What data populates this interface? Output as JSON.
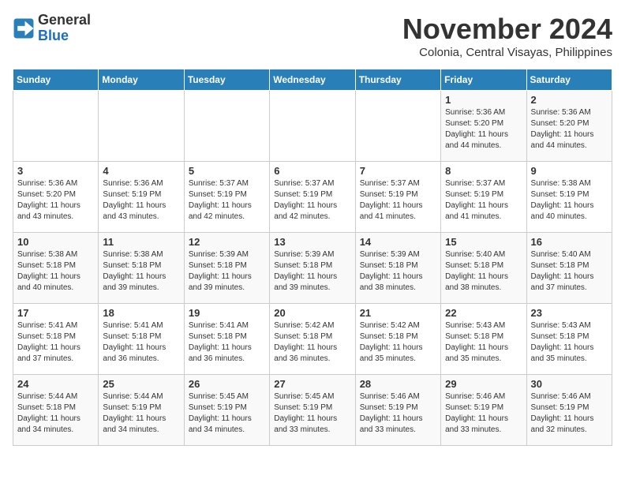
{
  "logo": {
    "line1": "General",
    "line2": "Blue"
  },
  "title": "November 2024",
  "subtitle": "Colonia, Central Visayas, Philippines",
  "days_of_week": [
    "Sunday",
    "Monday",
    "Tuesday",
    "Wednesday",
    "Thursday",
    "Friday",
    "Saturday"
  ],
  "weeks": [
    [
      {
        "day": "",
        "info": ""
      },
      {
        "day": "",
        "info": ""
      },
      {
        "day": "",
        "info": ""
      },
      {
        "day": "",
        "info": ""
      },
      {
        "day": "",
        "info": ""
      },
      {
        "day": "1",
        "info": "Sunrise: 5:36 AM\nSunset: 5:20 PM\nDaylight: 11 hours\nand 44 minutes."
      },
      {
        "day": "2",
        "info": "Sunrise: 5:36 AM\nSunset: 5:20 PM\nDaylight: 11 hours\nand 44 minutes."
      }
    ],
    [
      {
        "day": "3",
        "info": "Sunrise: 5:36 AM\nSunset: 5:20 PM\nDaylight: 11 hours\nand 43 minutes."
      },
      {
        "day": "4",
        "info": "Sunrise: 5:36 AM\nSunset: 5:19 PM\nDaylight: 11 hours\nand 43 minutes."
      },
      {
        "day": "5",
        "info": "Sunrise: 5:37 AM\nSunset: 5:19 PM\nDaylight: 11 hours\nand 42 minutes."
      },
      {
        "day": "6",
        "info": "Sunrise: 5:37 AM\nSunset: 5:19 PM\nDaylight: 11 hours\nand 42 minutes."
      },
      {
        "day": "7",
        "info": "Sunrise: 5:37 AM\nSunset: 5:19 PM\nDaylight: 11 hours\nand 41 minutes."
      },
      {
        "day": "8",
        "info": "Sunrise: 5:37 AM\nSunset: 5:19 PM\nDaylight: 11 hours\nand 41 minutes."
      },
      {
        "day": "9",
        "info": "Sunrise: 5:38 AM\nSunset: 5:19 PM\nDaylight: 11 hours\nand 40 minutes."
      }
    ],
    [
      {
        "day": "10",
        "info": "Sunrise: 5:38 AM\nSunset: 5:18 PM\nDaylight: 11 hours\nand 40 minutes."
      },
      {
        "day": "11",
        "info": "Sunrise: 5:38 AM\nSunset: 5:18 PM\nDaylight: 11 hours\nand 39 minutes."
      },
      {
        "day": "12",
        "info": "Sunrise: 5:39 AM\nSunset: 5:18 PM\nDaylight: 11 hours\nand 39 minutes."
      },
      {
        "day": "13",
        "info": "Sunrise: 5:39 AM\nSunset: 5:18 PM\nDaylight: 11 hours\nand 39 minutes."
      },
      {
        "day": "14",
        "info": "Sunrise: 5:39 AM\nSunset: 5:18 PM\nDaylight: 11 hours\nand 38 minutes."
      },
      {
        "day": "15",
        "info": "Sunrise: 5:40 AM\nSunset: 5:18 PM\nDaylight: 11 hours\nand 38 minutes."
      },
      {
        "day": "16",
        "info": "Sunrise: 5:40 AM\nSunset: 5:18 PM\nDaylight: 11 hours\nand 37 minutes."
      }
    ],
    [
      {
        "day": "17",
        "info": "Sunrise: 5:41 AM\nSunset: 5:18 PM\nDaylight: 11 hours\nand 37 minutes."
      },
      {
        "day": "18",
        "info": "Sunrise: 5:41 AM\nSunset: 5:18 PM\nDaylight: 11 hours\nand 36 minutes."
      },
      {
        "day": "19",
        "info": "Sunrise: 5:41 AM\nSunset: 5:18 PM\nDaylight: 11 hours\nand 36 minutes."
      },
      {
        "day": "20",
        "info": "Sunrise: 5:42 AM\nSunset: 5:18 PM\nDaylight: 11 hours\nand 36 minutes."
      },
      {
        "day": "21",
        "info": "Sunrise: 5:42 AM\nSunset: 5:18 PM\nDaylight: 11 hours\nand 35 minutes."
      },
      {
        "day": "22",
        "info": "Sunrise: 5:43 AM\nSunset: 5:18 PM\nDaylight: 11 hours\nand 35 minutes."
      },
      {
        "day": "23",
        "info": "Sunrise: 5:43 AM\nSunset: 5:18 PM\nDaylight: 11 hours\nand 35 minutes."
      }
    ],
    [
      {
        "day": "24",
        "info": "Sunrise: 5:44 AM\nSunset: 5:18 PM\nDaylight: 11 hours\nand 34 minutes."
      },
      {
        "day": "25",
        "info": "Sunrise: 5:44 AM\nSunset: 5:19 PM\nDaylight: 11 hours\nand 34 minutes."
      },
      {
        "day": "26",
        "info": "Sunrise: 5:45 AM\nSunset: 5:19 PM\nDaylight: 11 hours\nand 34 minutes."
      },
      {
        "day": "27",
        "info": "Sunrise: 5:45 AM\nSunset: 5:19 PM\nDaylight: 11 hours\nand 33 minutes."
      },
      {
        "day": "28",
        "info": "Sunrise: 5:46 AM\nSunset: 5:19 PM\nDaylight: 11 hours\nand 33 minutes."
      },
      {
        "day": "29",
        "info": "Sunrise: 5:46 AM\nSunset: 5:19 PM\nDaylight: 11 hours\nand 33 minutes."
      },
      {
        "day": "30",
        "info": "Sunrise: 5:46 AM\nSunset: 5:19 PM\nDaylight: 11 hours\nand 32 minutes."
      }
    ]
  ]
}
